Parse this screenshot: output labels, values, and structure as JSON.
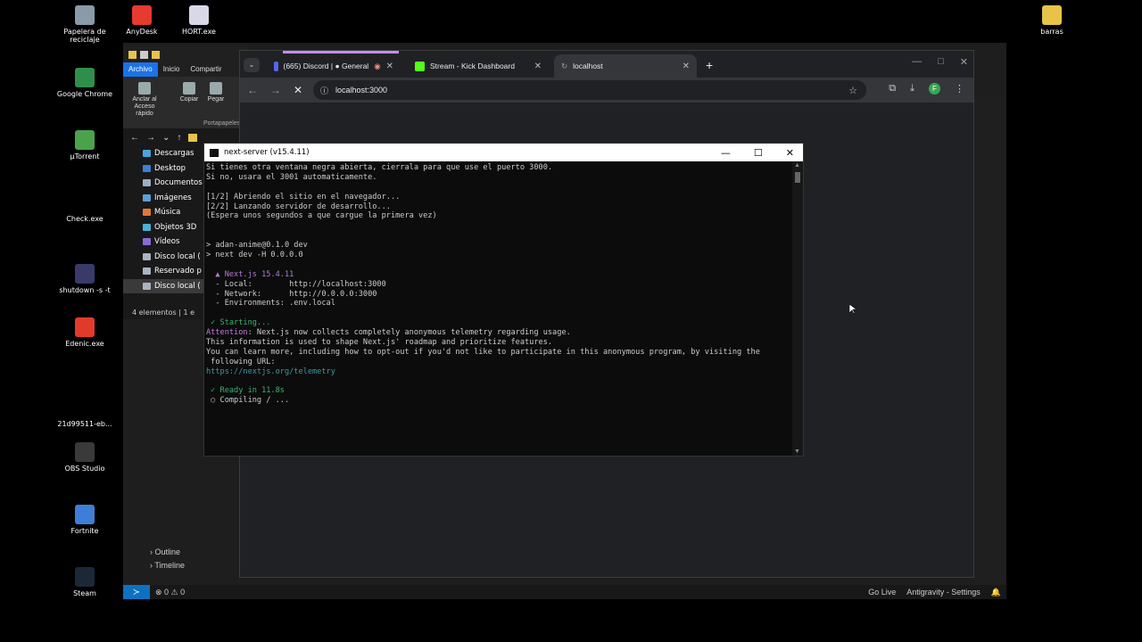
{
  "desktop": {
    "icons": [
      {
        "label": "Papelera de reciclaje",
        "color": "#8a9aa8"
      },
      {
        "label": "AnyDesk",
        "color": "#e63b2e"
      },
      {
        "label": "HORT.exe",
        "color": "#d8d8e8"
      },
      {
        "label": "Google Chrome",
        "color": "#2f8f4a"
      },
      {
        "label": "µTorrent",
        "color": "#4aa34a"
      },
      {
        "label": "Check.exe",
        "color": "#000000"
      },
      {
        "label": "shutdown -s -t",
        "color": "#3a3a6a"
      },
      {
        "label": "Edenic.exe",
        "color": "#e23a2a"
      },
      {
        "label": "21d99511-eb...",
        "color": "#000000"
      },
      {
        "label": "OBS Studio",
        "color": "#3a3a3a"
      },
      {
        "label": "Fortnite",
        "color": "#3d7fd6"
      },
      {
        "label": "Steam",
        "color": "#1b2838"
      },
      {
        "label": "barras",
        "color": "#e8c34a"
      }
    ]
  },
  "explorer": {
    "tabs": [
      "Archivo",
      "Inicio",
      "Compartir"
    ],
    "ribbon": {
      "pin_label": "Anclar al Acceso rápido",
      "copy_label": "Copiar",
      "paste_label": "Pegar",
      "group_label": "Portapapeles"
    },
    "tree": [
      {
        "label": "Descargas",
        "color": "#4aa3df"
      },
      {
        "label": "Desktop",
        "color": "#3c7fd6"
      },
      {
        "label": "Documentos",
        "color": "#9bb0c4"
      },
      {
        "label": "Imágenes",
        "color": "#5aa0d8"
      },
      {
        "label": "Música",
        "color": "#e07a3a"
      },
      {
        "label": "Objetos 3D",
        "color": "#4ab0d8"
      },
      {
        "label": "Vídeos",
        "color": "#8a6ad8"
      },
      {
        "label": "Disco local (",
        "color": "#aab4c0"
      },
      {
        "label": "Reservado p",
        "color": "#aab4c0"
      },
      {
        "label": "Disco local (",
        "color": "#aab4c0"
      }
    ],
    "status": "4 elementos | 1 e"
  },
  "vscode": {
    "outline_label": "Outline",
    "timeline_label": "Timeline",
    "errors": "⊗ 0 ⚠ 0",
    "golive": "Go Live",
    "settings": "Antigravity - Settings"
  },
  "chrome": {
    "tabs": [
      {
        "title": "(665) Discord | ● General",
        "fav_color": "#5865f2"
      },
      {
        "title": "Stream - Kick Dashboard",
        "fav_color": "#53fc18"
      },
      {
        "title": "localhost",
        "fav_color": "#9aa0a6"
      }
    ],
    "url": "localhost:3000",
    "profile_initial": "F"
  },
  "terminal": {
    "title": "next-server (v15.4.11)",
    "lines": [
      {
        "t": "Si tienes otra ventana negra abierta, cierrala para que use el puerto 3000."
      },
      {
        "t": "Si no, usara el 3001 automaticamente."
      },
      {
        "t": ""
      },
      {
        "t": "[1/2] Abriendo el sitio en el navegador..."
      },
      {
        "t": "[2/2] Lanzando servidor de desarrollo..."
      },
      {
        "t": "(Espera unos segundos a que cargue la primera vez)"
      },
      {
        "t": ""
      },
      {
        "t": ""
      },
      {
        "t": "> adan-anime@0.1.0 dev"
      },
      {
        "t": "> next dev -H 0.0.0.0"
      },
      {
        "t": ""
      },
      {
        "t": "  ▲ Next.js 15.4.11",
        "c": "next"
      },
      {
        "t": "  - Local:        http://localhost:3000"
      },
      {
        "t": "  - Network:      http://0.0.0.0:3000"
      },
      {
        "t": "  - Environments: .env.local"
      },
      {
        "t": ""
      },
      {
        "t": " ✓ Starting...",
        "c": "green"
      },
      {
        "pre": "Attention",
        "t": ": Next.js now collects completely anonymous telemetry regarding usage."
      },
      {
        "t": "This information is used to shape Next.js' roadmap and prioritize features."
      },
      {
        "t": "You can learn more, including how to opt-out if you'd not like to participate in this anonymous program, by visiting the"
      },
      {
        "t": " following URL:"
      },
      {
        "t": "https://nextjs.org/telemetry",
        "c": "link"
      },
      {
        "t": ""
      },
      {
        "t": " ✓ Ready in 11.8s",
        "c": "green"
      },
      {
        "t": " ○ Compiling / ..."
      }
    ]
  }
}
